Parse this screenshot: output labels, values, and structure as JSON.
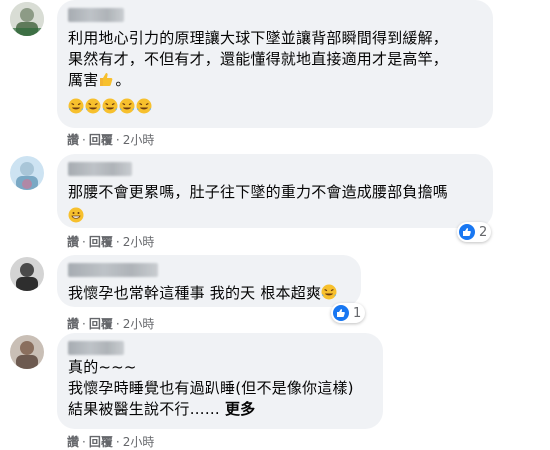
{
  "comments": [
    {
      "text": "利用地心引力的原理讓大球下墜並讓背部瞬間得到緩解，\n果然有才，不但有才，還能懂得就地直接適用才是高竿，\n厲害",
      "actions": {
        "like": "讚",
        "reply": "回覆",
        "time": "2小時"
      },
      "emojis": [
        "rofl-emoji",
        "rofl-emoji",
        "rofl-emoji",
        "rofl-emoji",
        "rofl-emoji"
      ]
    },
    {
      "text": "那腰不會更累嗎，肚子往下墜的重力不會造成腰部負擔嗎",
      "actions": {
        "like": "讚",
        "reply": "回覆",
        "time": "2小時"
      },
      "reaction_count": "2"
    },
    {
      "text": "我懷孕也常幹這種事 我的天 根本超爽",
      "actions": {
        "like": "讚",
        "reply": "回覆",
        "time": "2小時"
      },
      "reaction_count": "1"
    },
    {
      "text": "真的~~~\n我懷孕時睡覺也有過趴睡(但不是像你這樣)\n結果被醫生說不行……",
      "more": "更多",
      "actions": {
        "like": "讚",
        "reply": "回覆",
        "time": "2小時"
      }
    }
  ],
  "colors": {
    "bubble": "#f0f2f5",
    "meta_text": "#65676b",
    "like_blue": "#1877f2",
    "emoji_yellow": "#f7c02d"
  }
}
